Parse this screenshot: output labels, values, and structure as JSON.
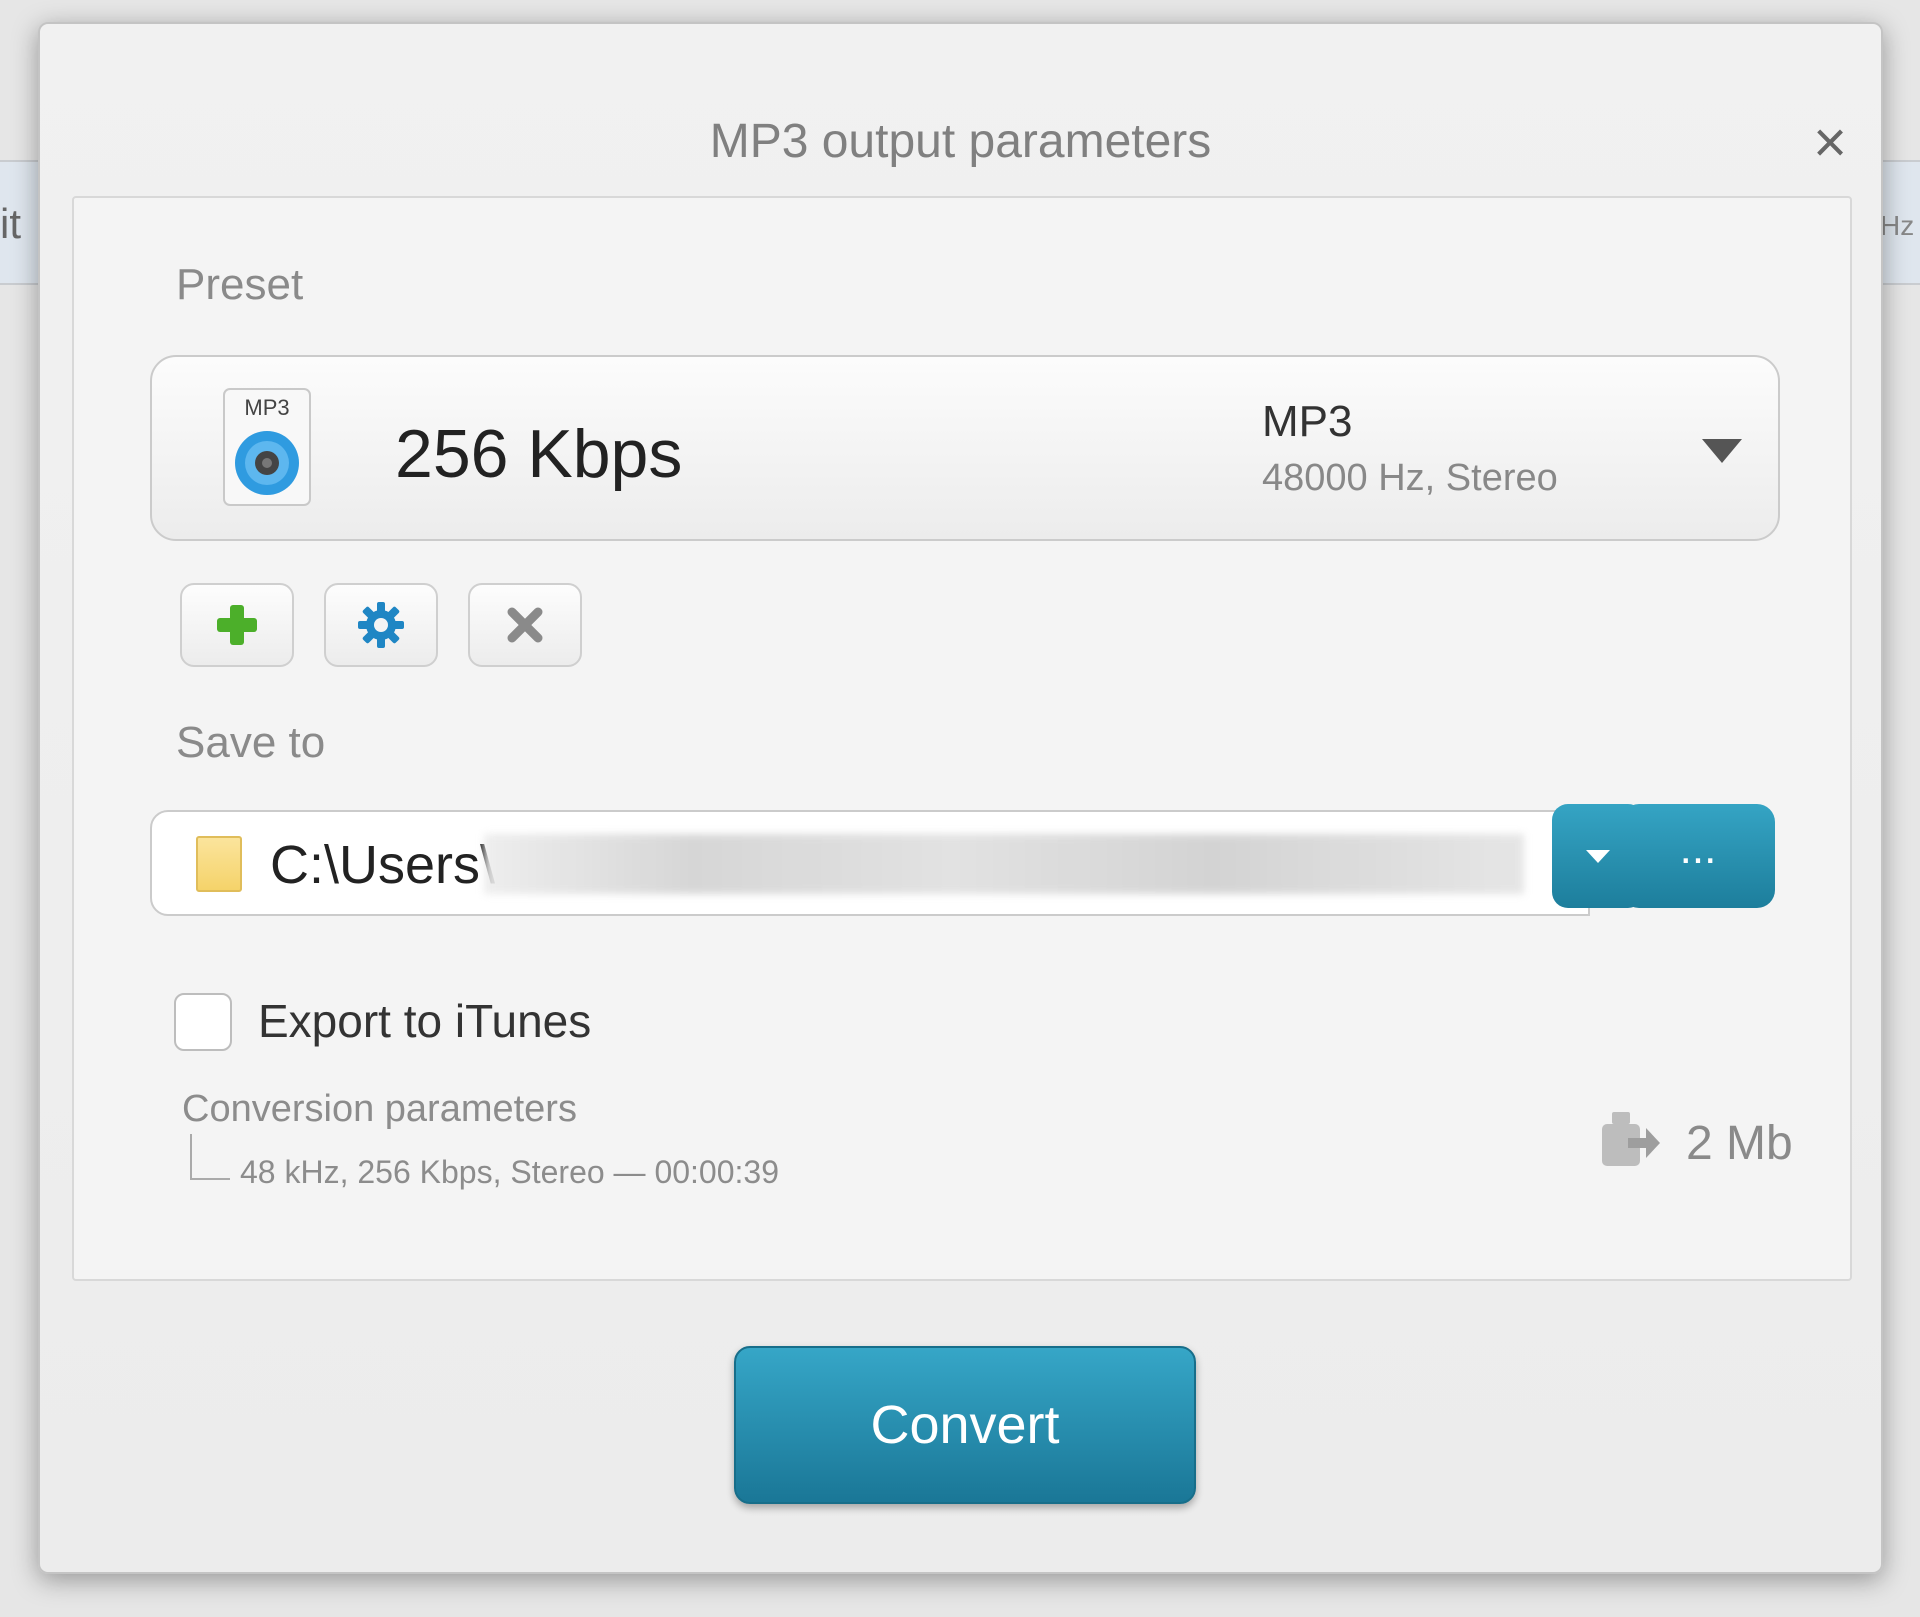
{
  "dialog": {
    "title": "MP3 output parameters",
    "close_icon": "close-icon"
  },
  "background": {
    "left_fragment": "it",
    "right_fragment": "Hz"
  },
  "preset": {
    "label": "Preset",
    "icon": "mp3-file-icon",
    "icon_label": "MP3",
    "name": "256 Kbps",
    "format": "MP3",
    "details": "48000 Hz,  Stereo",
    "dropdown_icon": "chevron-down-icon",
    "tools": [
      {
        "name": "add-preset-button",
        "icon": "plus-icon",
        "color": "#4caf2a"
      },
      {
        "name": "preset-settings-button",
        "icon": "gear-icon",
        "color": "#1f86c4"
      },
      {
        "name": "delete-preset-button",
        "icon": "x-icon",
        "color": "#8a8a8a"
      }
    ]
  },
  "save_to": {
    "label": "Save to",
    "folder_icon": "folder-icon",
    "path_visible": "C:\\Users\\",
    "browse_label": "..."
  },
  "export": {
    "label": "Export to iTunes",
    "checked": false
  },
  "conversion": {
    "title": "Conversion parameters",
    "details": "48 kHz, 256 Kbps, Stereo — 00:00:39",
    "size_icon": "export-size-icon",
    "size": "2 Mb"
  },
  "convert_label": "Convert",
  "colors": {
    "accent": "#2a8fb0",
    "accent_dark": "#1a7797"
  }
}
